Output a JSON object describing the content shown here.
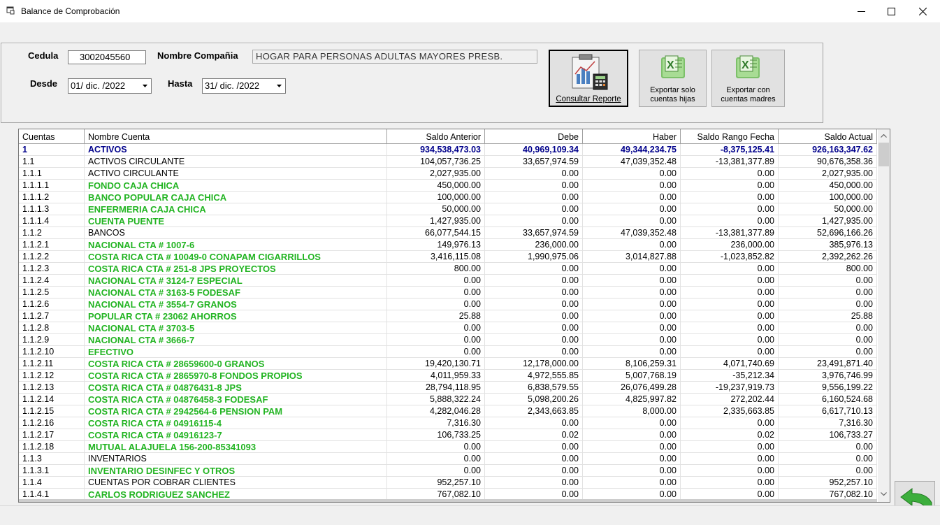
{
  "window": {
    "title": "Balance de Comprobación"
  },
  "form": {
    "cedula_label": "Cedula",
    "cedula_value": "3002045560",
    "company_label": "Nombre Compañia",
    "company_value": "HOGAR PARA PERSONAS ADULTAS MAYORES  PRESB.",
    "desde_label": "Desde",
    "desde_value": "01/ dic. /2022",
    "hasta_label": "Hasta",
    "hasta_value": "31/ dic. /2022"
  },
  "buttons": {
    "consultar": "Consultar Reporte",
    "exportar_hijas_1": "Exportar solo",
    "exportar_hijas_2": "cuentas hijas",
    "exportar_madres_1": "Exportar con",
    "exportar_madres_2": "cuentas madres"
  },
  "table": {
    "headers": [
      "Cuentas",
      "Nombre Cuenta",
      "Saldo Anterior",
      "Debe",
      "Haber",
      "Saldo Rango Fecha",
      "Saldo Actual"
    ],
    "rows": [
      {
        "level": "root",
        "cuenta": "1",
        "nombre": "ACTIVOS",
        "anterior": "934,538,473.03",
        "debe": "40,969,109.34",
        "haber": "49,344,234.75",
        "rango": "-8,375,125.41",
        "actual": "926,163,347.62"
      },
      {
        "level": "mid",
        "cuenta": "1.1",
        "nombre": "ACTIVOS CIRCULANTE",
        "anterior": "104,057,736.25",
        "debe": "33,657,974.59",
        "haber": "47,039,352.48",
        "rango": "-13,381,377.89",
        "actual": "90,676,358.36"
      },
      {
        "level": "mid",
        "cuenta": "1.1.1",
        "nombre": "ACTIVO CIRCULANTE",
        "anterior": "2,027,935.00",
        "debe": "0.00",
        "haber": "0.00",
        "rango": "0.00",
        "actual": "2,027,935.00"
      },
      {
        "level": "leaf",
        "cuenta": "1.1.1.1",
        "nombre": "FONDO CAJA CHICA",
        "anterior": "450,000.00",
        "debe": "0.00",
        "haber": "0.00",
        "rango": "0.00",
        "actual": "450,000.00"
      },
      {
        "level": "leaf",
        "cuenta": "1.1.1.2",
        "nombre": "BANCO POPULAR CAJA CHICA",
        "anterior": "100,000.00",
        "debe": "0.00",
        "haber": "0.00",
        "rango": "0.00",
        "actual": "100,000.00"
      },
      {
        "level": "leaf",
        "cuenta": "1.1.1.3",
        "nombre": "ENFERMERIA CAJA CHICA",
        "anterior": "50,000.00",
        "debe": "0.00",
        "haber": "0.00",
        "rango": "0.00",
        "actual": "50,000.00"
      },
      {
        "level": "leaf",
        "cuenta": "1.1.1.4",
        "nombre": "CUENTA PUENTE",
        "anterior": "1,427,935.00",
        "debe": "0.00",
        "haber": "0.00",
        "rango": "0.00",
        "actual": "1,427,935.00"
      },
      {
        "level": "mid",
        "cuenta": "1.1.2",
        "nombre": "BANCOS",
        "anterior": "66,077,544.15",
        "debe": "33,657,974.59",
        "haber": "47,039,352.48",
        "rango": "-13,381,377.89",
        "actual": "52,696,166.26"
      },
      {
        "level": "leaf",
        "cuenta": "1.1.2.1",
        "nombre": "NACIONAL CTA # 1007-6",
        "anterior": "149,976.13",
        "debe": "236,000.00",
        "haber": "0.00",
        "rango": "236,000.00",
        "actual": "385,976.13"
      },
      {
        "level": "leaf",
        "cuenta": "1.1.2.2",
        "nombre": "COSTA RICA CTA # 10049-0 CONAPAM CIGARRILLOS",
        "anterior": "3,416,115.08",
        "debe": "1,990,975.06",
        "haber": "3,014,827.88",
        "rango": "-1,023,852.82",
        "actual": "2,392,262.26"
      },
      {
        "level": "leaf",
        "cuenta": "1.1.2.3",
        "nombre": "COSTA RICA CTA # 251-8 JPS PROYECTOS",
        "anterior": "800.00",
        "debe": "0.00",
        "haber": "0.00",
        "rango": "0.00",
        "actual": "800.00"
      },
      {
        "level": "leaf",
        "cuenta": "1.1.2.4",
        "nombre": "NACIONAL CTA # 3124-7 ESPECIAL",
        "anterior": "0.00",
        "debe": "0.00",
        "haber": "0.00",
        "rango": "0.00",
        "actual": "0.00"
      },
      {
        "level": "leaf",
        "cuenta": "1.1.2.5",
        "nombre": "NACIONAL CTA # 3163-5 FODESAF",
        "anterior": "0.00",
        "debe": "0.00",
        "haber": "0.00",
        "rango": "0.00",
        "actual": "0.00"
      },
      {
        "level": "leaf",
        "cuenta": "1.1.2.6",
        "nombre": "NACIONAL CTA # 3554-7 GRANOS",
        "anterior": "0.00",
        "debe": "0.00",
        "haber": "0.00",
        "rango": "0.00",
        "actual": "0.00"
      },
      {
        "level": "leaf",
        "cuenta": "1.1.2.7",
        "nombre": "POPULAR CTA # 23062 AHORROS",
        "anterior": "25.88",
        "debe": "0.00",
        "haber": "0.00",
        "rango": "0.00",
        "actual": "25.88"
      },
      {
        "level": "leaf",
        "cuenta": "1.1.2.8",
        "nombre": "NACIONAL CTA # 3703-5",
        "anterior": "0.00",
        "debe": "0.00",
        "haber": "0.00",
        "rango": "0.00",
        "actual": "0.00"
      },
      {
        "level": "leaf",
        "cuenta": "1.1.2.9",
        "nombre": "NACIONAL CTA # 3666-7",
        "anterior": "0.00",
        "debe": "0.00",
        "haber": "0.00",
        "rango": "0.00",
        "actual": "0.00"
      },
      {
        "level": "leaf",
        "cuenta": "1.1.2.10",
        "nombre": "EFECTIVO",
        "anterior": "0.00",
        "debe": "0.00",
        "haber": "0.00",
        "rango": "0.00",
        "actual": "0.00"
      },
      {
        "level": "leaf",
        "cuenta": "1.1.2.11",
        "nombre": "COSTA RICA CTA # 28659600-0 GRANOS",
        "anterior": "19,420,130.71",
        "debe": "12,178,000.00",
        "haber": "8,106,259.31",
        "rango": "4,071,740.69",
        "actual": "23,491,871.40"
      },
      {
        "level": "leaf",
        "cuenta": "1.1.2.12",
        "nombre": "COSTA RICA CTA # 2865970-8 FONDOS PROPIOS",
        "anterior": "4,011,959.33",
        "debe": "4,972,555.85",
        "haber": "5,007,768.19",
        "rango": "-35,212.34",
        "actual": "3,976,746.99"
      },
      {
        "level": "leaf",
        "cuenta": "1.1.2.13",
        "nombre": "COSTA RICA CTA # 04876431-8 JPS",
        "anterior": "28,794,118.95",
        "debe": "6,838,579.55",
        "haber": "26,076,499.28",
        "rango": "-19,237,919.73",
        "actual": "9,556,199.22"
      },
      {
        "level": "leaf",
        "cuenta": "1.1.2.14",
        "nombre": "COSTA RICA CTA # 04876458-3 FODESAF",
        "anterior": "5,888,322.24",
        "debe": "5,098,200.26",
        "haber": "4,825,997.82",
        "rango": "272,202.44",
        "actual": "6,160,524.68"
      },
      {
        "level": "leaf",
        "cuenta": "1.1.2.15",
        "nombre": "COSTA RICA CTA # 2942564-6 PENSION PAM",
        "anterior": "4,282,046.28",
        "debe": "2,343,663.85",
        "haber": "8,000.00",
        "rango": "2,335,663.85",
        "actual": "6,617,710.13"
      },
      {
        "level": "leaf",
        "cuenta": "1.1.2.16",
        "nombre": "COSTA RICA CTA # 04916115-4",
        "anterior": "7,316.30",
        "debe": "0.00",
        "haber": "0.00",
        "rango": "0.00",
        "actual": "7,316.30"
      },
      {
        "level": "leaf",
        "cuenta": "1.1.2.17",
        "nombre": "COSTA RICA CTA # 04916123-7",
        "anterior": "106,733.25",
        "debe": "0.02",
        "haber": "0.00",
        "rango": "0.02",
        "actual": "106,733.27"
      },
      {
        "level": "leaf",
        "cuenta": "1.1.2.18",
        "nombre": "MUTUAL ALAJUELA 156-200-85341093",
        "anterior": "0.00",
        "debe": "0.00",
        "haber": "0.00",
        "rango": "0.00",
        "actual": "0.00"
      },
      {
        "level": "mid",
        "cuenta": "1.1.3",
        "nombre": "INVENTARIOS",
        "anterior": "0.00",
        "debe": "0.00",
        "haber": "0.00",
        "rango": "0.00",
        "actual": "0.00"
      },
      {
        "level": "leaf",
        "cuenta": "1.1.3.1",
        "nombre": "INVENTARIO DESINFEC Y OTROS",
        "anterior": "0.00",
        "debe": "0.00",
        "haber": "0.00",
        "rango": "0.00",
        "actual": "0.00"
      },
      {
        "level": "mid",
        "cuenta": "1.1.4",
        "nombre": "CUENTAS POR COBRAR CLIENTES",
        "anterior": "952,257.10",
        "debe": "0.00",
        "haber": "0.00",
        "rango": "0.00",
        "actual": "952,257.10"
      },
      {
        "level": "leaf",
        "cuenta": "1.1.4.1",
        "nombre": "CARLOS RODRIGUEZ SANCHEZ",
        "anterior": "767,082.10",
        "debe": "0.00",
        "haber": "0.00",
        "rango": "0.00",
        "actual": "767,082.10"
      }
    ]
  },
  "colors": {
    "root": "#00008b",
    "leaf": "#22b422",
    "mid": "#000000"
  },
  "icons": {
    "app": "form-icon",
    "minimize": "minimize-icon",
    "maximize": "maximize-icon",
    "close": "close-icon",
    "back": "back-arrow-icon",
    "excel": "excel-icon",
    "report": "report-icon"
  }
}
